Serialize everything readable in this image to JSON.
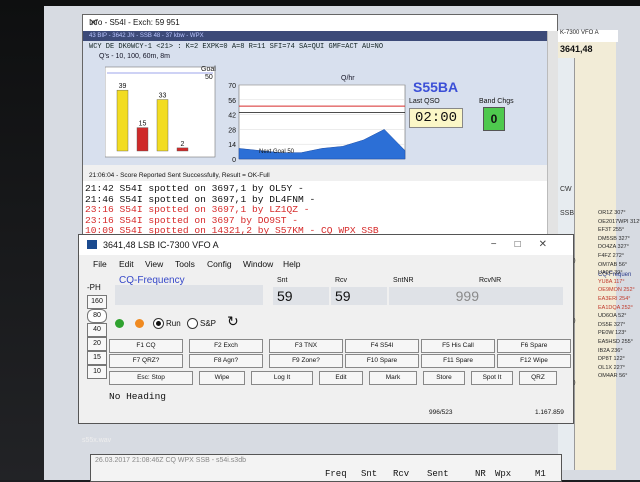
{
  "info_window": {
    "title": "Info - S54I - Exch: 59 951",
    "top_line": "43 BIP - 3642 JN - SSB 48 - 37 kbw - WPX",
    "callsign_line": "WCY DE DK0WCY-1 <21> : K=2 EXPK=0 A=8 R=11 SFI=74 SA=QUI GMF=ACT AU=NO",
    "qs_title": "Q's - 10, 100, 60m, 8m",
    "goal_label": "Goal",
    "goal_value": "50",
    "qhr_title": "Q/hr",
    "next_goal": "Next Goal 50",
    "station": "S55BA",
    "last_qso_label": "Last QSO",
    "last_qso": "02:00",
    "band_chgs_label": "Band Chgs",
    "band_chgs": "0",
    "score_line": "21:06:04 - Score Reported Sent Successfully, Result = OK-Full",
    "spots": [
      {
        "text": "21:42 S54I spotted on 3697,1 by OL5Y -",
        "color": "#111111"
      },
      {
        "text": "21:46 S54I spotted on 3697,1 by DL4FNM -",
        "color": "#111111"
      },
      {
        "text": "23:16 S54I spotted on 3697,1 by LZ1QZ -",
        "color": "#d62a2a"
      },
      {
        "text": "23:16 S54I spotted on 3697 by DO9ST -",
        "color": "#d62a2a"
      },
      {
        "text": "10:09 S54I spotted on 14321,2 by S57KM - CQ WPX SSB",
        "color": "#d62a2a"
      }
    ]
  },
  "chart_data": [
    {
      "type": "bar",
      "title": "Q's - 10, 100, 60m, 8m",
      "categories": [
        "1",
        "2",
        "3",
        "4"
      ],
      "values": [
        39,
        15,
        33,
        2
      ],
      "ylim": [
        0,
        50
      ],
      "colors": [
        "#f2dc22",
        "#cf2a2a",
        "#f2dc22",
        "#cf2a2a"
      ]
    },
    {
      "type": "area",
      "title": "Q/hr",
      "xlabel": "Next Goal 50",
      "yticks": [
        70,
        56,
        42,
        28,
        14,
        0
      ],
      "ylim": [
        0,
        70
      ],
      "x": [
        0,
        1,
        2,
        3,
        4,
        5,
        6,
        7,
        8
      ],
      "values": [
        10,
        8,
        6,
        6,
        10,
        12,
        18,
        28,
        8
      ],
      "goal_line": 50,
      "avg_line": 44
    }
  ],
  "bandmap": {
    "title": "K-7300 VFO A",
    "freq": "3641,48",
    "ticks": [
      "3650",
      "3700",
      "3750"
    ],
    "mode_labels": [
      "CW",
      "SSB"
    ],
    "cq_label": "CQ-Frequen",
    "spots": [
      "OR1Z 307°",
      "OE2017WPI 312°",
      "EF3T 255°",
      "DM5SB 327°",
      "DO4ZA 327°",
      "F4FZ 272°",
      "OM7AB 56°",
      "UA9C 39°",
      "YU8A 117°",
      "OE9MON 252°",
      "EA3ERI 254°",
      "EA1DQA 252°",
      "UD6OA 52°",
      "DS5E 327°",
      "PE0W 123°",
      "EA5HSD 255°",
      "IB2A 236°",
      "DP8T 122°",
      "OL1X 227°",
      "OM4AR 56°"
    ]
  },
  "entry_window": {
    "title": "3641,48 LSB IC-7300 VFO A",
    "menu": [
      "File",
      "Edit",
      "View",
      "Tools",
      "Config",
      "Window",
      "Help"
    ],
    "ph_label": "-PH",
    "ph_buttons": [
      "160",
      "80",
      "40",
      "20",
      "15",
      "10"
    ],
    "cq_frequency": "CQ-Frequency",
    "fields": {
      "snt_label": "Snt",
      "snt": "59",
      "rcv_label": "Rcv",
      "rcv": "59",
      "sntnr_label": "SntNR",
      "sntnr": "999",
      "rcvnr_label": "RcvNR",
      "rcvnr": ""
    },
    "run_label": "Run",
    "sp_label": "S&P",
    "fkeys_row1": [
      "F1 CQ",
      "F2 Exch",
      "F3 TNX",
      "F4 S54I",
      "F5 His Call",
      "F6 Spare"
    ],
    "fkeys_row2": [
      "F7 QRZ?",
      "F8 Agn?",
      "F9 Zone?",
      "F10 Spare",
      "F11 Spare",
      "F12 Wipe"
    ],
    "bottom_buttons": [
      "Esc: Stop",
      "Wipe",
      "Log It",
      "Edit",
      "Mark",
      "Store",
      "Spot It",
      "QRZ"
    ],
    "no_heading": "No Heading",
    "status_count": "996/523",
    "status_score": "1.167.859"
  },
  "wav_file": "s55x.wav",
  "log_window": {
    "title": "26.03.2017 21:08:46Z CQ WPX SSB - s54i.s3db",
    "columns": [
      "Freq",
      "Snt",
      "Rcv",
      "Sent",
      "NR",
      "Wpx",
      "M1"
    ]
  },
  "colors": {
    "accent_blue": "#3b4fd7",
    "spot_red": "#d62a2a",
    "green": "#4ec94e"
  }
}
